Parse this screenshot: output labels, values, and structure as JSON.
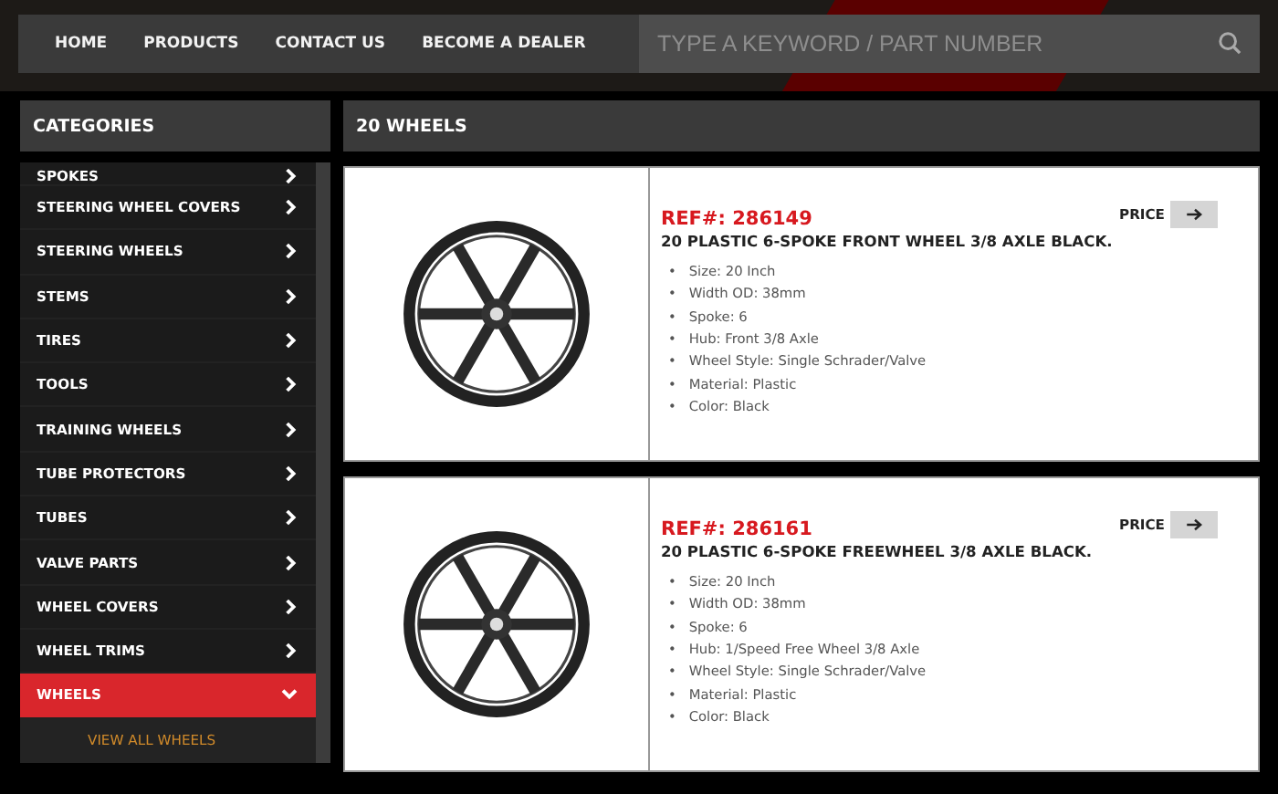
{
  "nav": {
    "links": [
      "HOME",
      "PRODUCTS",
      "CONTACT US",
      "BECOME A DEALER"
    ],
    "search": {
      "placeholder": "TYPE A KEYWORD / PART NUMBER"
    }
  },
  "sidebar": {
    "title": "CATEGORIES",
    "items": [
      {
        "label": "SPOKES",
        "selected": false
      },
      {
        "label": "STEERING WHEEL COVERS",
        "selected": false
      },
      {
        "label": "STEERING WHEELS",
        "selected": false
      },
      {
        "label": "STEMS",
        "selected": false
      },
      {
        "label": "TIRES",
        "selected": false
      },
      {
        "label": "TOOLS",
        "selected": false
      },
      {
        "label": "TRAINING WHEELS",
        "selected": false
      },
      {
        "label": "TUBE PROTECTORS",
        "selected": false
      },
      {
        "label": "TUBES",
        "selected": false
      },
      {
        "label": "VALVE PARTS",
        "selected": false
      },
      {
        "label": "WHEEL COVERS",
        "selected": false
      },
      {
        "label": "WHEEL TRIMS",
        "selected": false
      },
      {
        "label": "WHEELS",
        "selected": true,
        "children": [
          {
            "label": "VIEW ALL WHEELS"
          }
        ]
      }
    ]
  },
  "main": {
    "title": "20 WHEELS",
    "products": [
      {
        "ref": "REF#: 286149",
        "bullet": "•",
        "name": "20 PLASTIC 6-SPOKE FRONT WHEEL 3/8 AXLE BLACK.",
        "price_label": "PRICE",
        "specs": [
          "Size: 20 Inch",
          "Width OD: 38mm",
          "Spoke: 6",
          "Hub: Front 3/8 Axle",
          "Wheel Style: Single Schrader/Valve",
          "Material: Plastic",
          "Color: Black"
        ]
      },
      {
        "ref": "REF#: 286161",
        "bullet": "•",
        "name": "20 PLASTIC 6-SPOKE FREEWHEEL 3/8 AXLE BLACK.",
        "price_label": "PRICE",
        "specs": [
          "Size: 20 Inch",
          "Width OD: 38mm",
          "Spoke: 6",
          "Hub: 1/Speed Free Wheel 3/8 Axle",
          "Wheel Style: Single Schrader/Valve",
          "Material: Plastic",
          "Color: Black"
        ]
      }
    ]
  }
}
